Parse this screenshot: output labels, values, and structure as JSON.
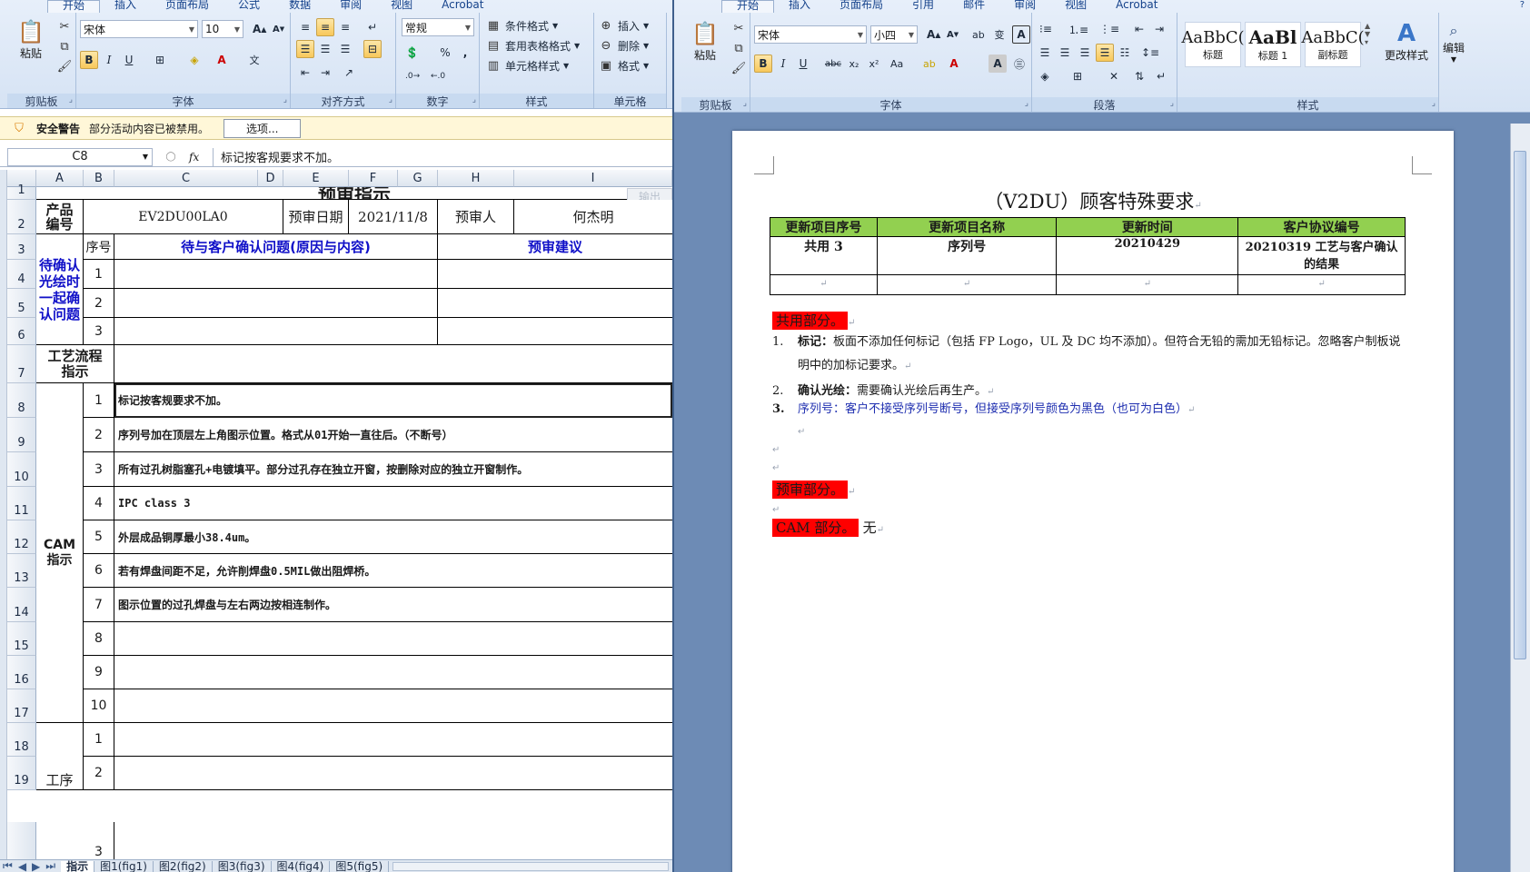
{
  "excel": {
    "tabs": [
      "开始",
      "插入",
      "页面布局",
      "公式",
      "数据",
      "审阅",
      "视图",
      "Acrobat"
    ],
    "ribbon": {
      "paste_label": "粘贴",
      "font_name": "宋体",
      "font_size": "10",
      "number_format": "常规",
      "percent": "%",
      "comma": ",",
      "cond_format": "条件格式",
      "table_format": "套用表格格式",
      "cell_style": "单元格样式",
      "insert": "插入",
      "delete": "删除",
      "format": "格式",
      "groups": [
        "剪贴板",
        "字体",
        "对齐方式",
        "数字",
        "样式",
        "单元格"
      ]
    },
    "security": {
      "title": "安全警告",
      "message": "部分活动内容已被禁用。",
      "button": "选项..."
    },
    "formula_bar": {
      "cell_ref": "C8",
      "fx": "fx",
      "content": "标记按客规要求不加。"
    },
    "columns": [
      "A",
      "B",
      "C",
      "D",
      "E",
      "F",
      "G",
      "H",
      "I"
    ],
    "rows": [
      "1",
      "2",
      "3",
      "4",
      "5",
      "6",
      "7",
      "8",
      "9",
      "10",
      "11",
      "12",
      "13",
      "14",
      "15",
      "16",
      "17",
      "18",
      "19"
    ],
    "sheet": {
      "title": "预审指示",
      "product_code_label": "产品\n编号",
      "product_code": "EV2DU00LA0",
      "review_date_label": "预审日期",
      "review_date": "2021/11/8",
      "reviewer_label": "预审人",
      "reviewer": "何杰明",
      "output_btn": "输出",
      "pending_label": "待确认\n光绘时\n一起确\n认问题",
      "seq_header": "序号",
      "issue_header": "待与客户确认问题(原因与内容)",
      "suggest_header": "预审建议",
      "pending_nums": [
        "1",
        "2",
        "3"
      ],
      "process_label": "工艺流程\n指示",
      "cam_label": "CAM\n指示",
      "cam_items": [
        {
          "n": "1",
          "text": "标记按客规要求不加。"
        },
        {
          "n": "2",
          "text": "序列号加在顶层左上角图示位置。格式从01开始一直往后。（不断号）"
        },
        {
          "n": "3",
          "text": "所有过孔树脂塞孔+电镀填平。部分过孔存在独立开窗，按删除对应的独立开窗制作。"
        },
        {
          "n": "4",
          "text": "IPC class 3"
        },
        {
          "n": "5",
          "text": "外层成品铜厚最小38.4um。"
        },
        {
          "n": "6",
          "text": "若有焊盘间距不足，允许削焊盘0.5MIL做出阻焊桥。"
        },
        {
          "n": "7",
          "text": "图示位置的过孔焊盘与左右两边按相连制作。"
        },
        {
          "n": "8",
          "text": ""
        },
        {
          "n": "9",
          "text": ""
        },
        {
          "n": "10",
          "text": ""
        }
      ],
      "proc_label": "工序",
      "proc_nums": [
        "1",
        "2",
        "3"
      ]
    },
    "sheet_tabs": [
      "指示",
      "图1(fig1)",
      "图2(fig2)",
      "图3(fig3)",
      "图4(fig4)",
      "图5(fig5)"
    ]
  },
  "word": {
    "tabs": [
      "开始",
      "插入",
      "页面布局",
      "引用",
      "邮件",
      "审阅",
      "视图",
      "Acrobat"
    ],
    "ribbon": {
      "paste_label": "粘贴",
      "font_name": "宋体",
      "font_size": "小四",
      "styles": [
        {
          "preview": "AaBbC(",
          "name": "标题"
        },
        {
          "preview": "AaBl",
          "name": "标题 1"
        },
        {
          "preview": "AaBbC(",
          "name": "副标题"
        }
      ],
      "change_styles": "更改样式",
      "edit": "编辑",
      "groups": [
        "剪贴板",
        "字体",
        "段落",
        "样式"
      ]
    },
    "doc": {
      "title": "（V2DU）顾客特殊要求",
      "table_headers": [
        "更新项目序号",
        "更新项目名称",
        "更新时间",
        "客户协议编号"
      ],
      "table_row": [
        "共用 3",
        "序列号",
        "20210429",
        "20210319 工艺与客户确认的结果"
      ],
      "common_label": "共用部分。",
      "items": [
        {
          "num": "1.",
          "bold": "标记：",
          "text": "板面不添加任何标记（包括 FP Logo，UL 及 DC 均不添加）。但符合无铅的需加无铅标记。忽略客户制板说明中的加标记要求。"
        },
        {
          "num": "2.",
          "bold": "确认光绘：",
          "text": "需要确认光绘后再生产。"
        },
        {
          "num": "3.",
          "bold": "序列号：",
          "text": "客户不接受序列号断号，但接受序列号颜色为黑色（也可为白色）"
        }
      ],
      "prereview_label": "预审部分。",
      "cam_label": "CAM 部分。",
      "cam_value": "无"
    }
  }
}
